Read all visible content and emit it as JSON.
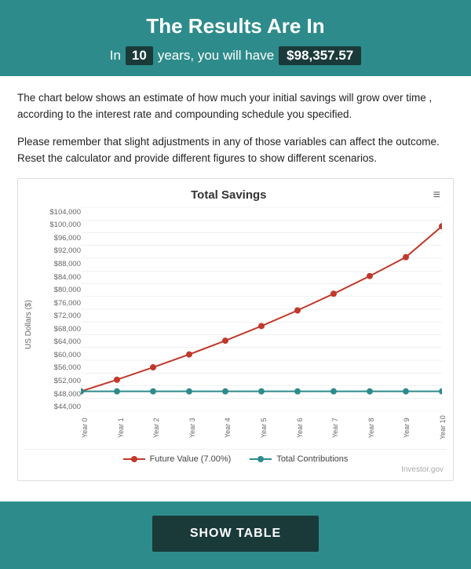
{
  "header": {
    "title": "The Results Are In",
    "subtitle_prefix": "In",
    "years": "10",
    "subtitle_middle": "years, you will have",
    "amount": "$98,357.57"
  },
  "description": {
    "paragraph1": "The chart below shows an estimate of how much your initial savings will grow over time , according to the interest rate and compounding schedule you specified.",
    "paragraph2": "Please remember that slight adjustments in any of those variables can affect the outcome. Reset the calculator and provide different figures to show different scenarios."
  },
  "chart": {
    "title": "Total Savings",
    "menu_icon": "≡",
    "y_axis_label": "US Dollars ($)",
    "y_labels": [
      "$104,000",
      "$100,000",
      "$96,000",
      "$92,000",
      "$88,000",
      "$84,000",
      "$80,000",
      "$76,000",
      "$72,000",
      "$68,000",
      "$64,000",
      "$60,000",
      "$56,000",
      "$52,000",
      "$48,000",
      "$44,000"
    ],
    "x_labels": [
      "Year 0",
      "Year 1",
      "Year 2",
      "Year 3",
      "Year 4",
      "Year 5",
      "Year 6",
      "Year 7",
      "Year 8",
      "Year 9",
      "Year 10"
    ],
    "future_value_data": [
      50000,
      53500,
      57245,
      61252,
      65540,
      70128,
      75037,
      80289,
      85909,
      91922,
      98358
    ],
    "contributions_data": [
      50000,
      50000,
      50000,
      50000,
      50000,
      50000,
      50000,
      50000,
      50000,
      50000,
      50000
    ],
    "legend": {
      "future_label": "Future Value (7.00%)",
      "contributions_label": "Total Contributions"
    },
    "credit": "Investor.gov"
  },
  "button": {
    "show_table": "SHOW TABLE"
  }
}
